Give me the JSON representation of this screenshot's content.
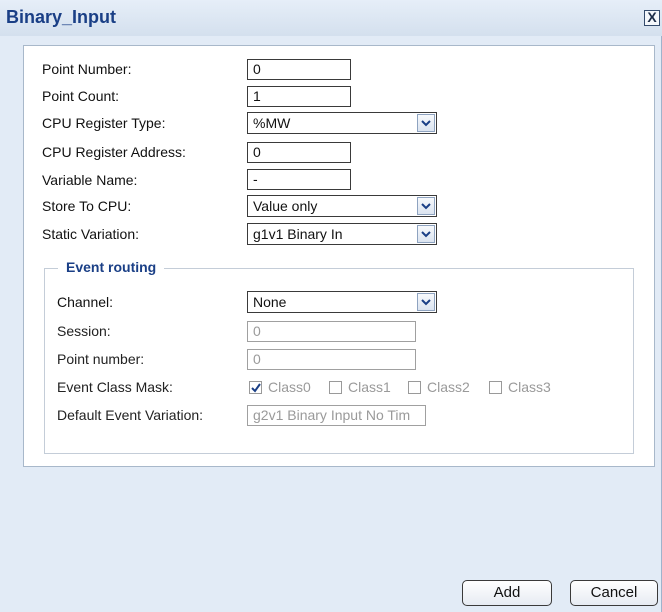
{
  "dialog": {
    "title": "Binary_Input",
    "close_label": "X"
  },
  "fields": {
    "point_number": {
      "label": "Point Number:",
      "value": "0"
    },
    "point_count": {
      "label": "Point Count:",
      "value": "1"
    },
    "cpu_register_type": {
      "label": "CPU Register Type:",
      "value": "%MW"
    },
    "cpu_register_address": {
      "label": "CPU Register Address:",
      "value": "0"
    },
    "variable_name": {
      "label": "Variable Name:",
      "value": "-"
    },
    "store_to_cpu": {
      "label": "Store To CPU:",
      "value": "Value only"
    },
    "static_variation": {
      "label": "Static Variation:",
      "value": "g1v1 Binary In"
    }
  },
  "event_routing": {
    "legend": "Event routing",
    "channel": {
      "label": "Channel:",
      "value": "None"
    },
    "session": {
      "label": "Session:",
      "value": "0"
    },
    "point_number": {
      "label": "Point number:",
      "value": "0"
    },
    "event_class_mask": {
      "label": "Event Class Mask:",
      "classes": [
        {
          "label": "Class0",
          "checked": true
        },
        {
          "label": "Class1",
          "checked": false
        },
        {
          "label": "Class2",
          "checked": false
        },
        {
          "label": "Class3",
          "checked": false
        }
      ]
    },
    "default_event_variation": {
      "label": "Default Event Variation:",
      "value": "g2v1 Binary Input No Tim"
    }
  },
  "buttons": {
    "add": "Add",
    "cancel": "Cancel"
  },
  "colors": {
    "title": "#1a3f86",
    "dialog_bg": "#e2ebf6",
    "disabled_text": "#9a9a9a"
  }
}
